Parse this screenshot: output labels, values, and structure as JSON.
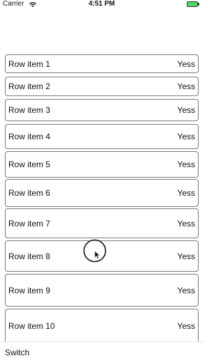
{
  "status_bar": {
    "carrier": "Carrier",
    "time": "4:51 PM",
    "battery_icon": "battery-icon",
    "wifi_icon": "wifi-icon",
    "battery_color": "#4cd964"
  },
  "rows": [
    {
      "label": "Row item 1",
      "value": "Yess"
    },
    {
      "label": "Row item 2",
      "value": "Yess"
    },
    {
      "label": "Row item 3",
      "value": "Yess"
    },
    {
      "label": "Row item 4",
      "value": "Yess"
    },
    {
      "label": "Row item 5",
      "value": "Yess"
    },
    {
      "label": "Row item 6",
      "value": "Yess"
    },
    {
      "label": "Row item 7",
      "value": "Yess"
    },
    {
      "label": "Row item 8",
      "value": "Yess"
    },
    {
      "label": "Row item 9",
      "value": "Yess"
    },
    {
      "label": "Row item 10",
      "value": "Yess"
    }
  ],
  "footer": {
    "switch_label": "Switch"
  }
}
